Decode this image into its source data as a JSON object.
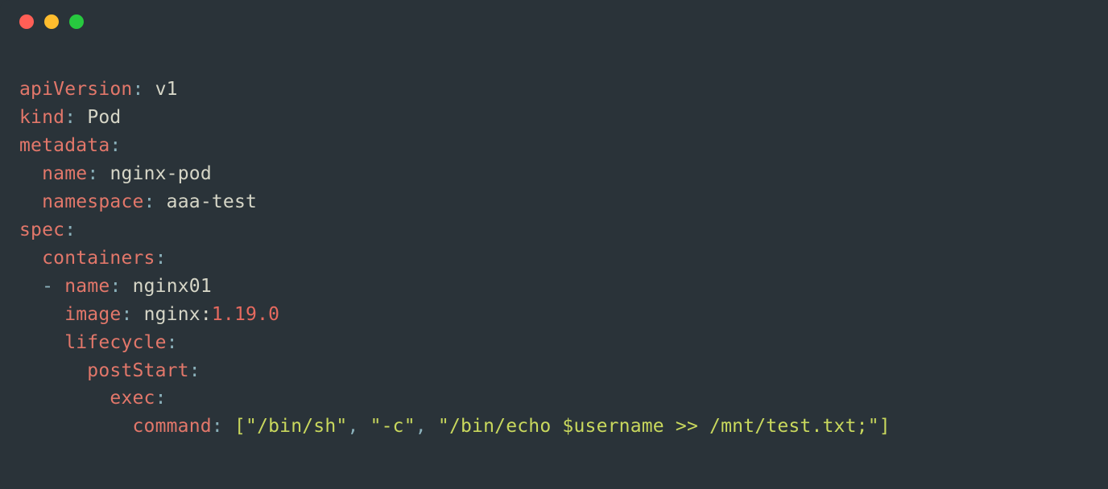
{
  "yaml": {
    "apiVersion_key": "apiVersion",
    "apiVersion_val": "v1",
    "kind_key": "kind",
    "kind_val": "Pod",
    "metadata_key": "metadata",
    "name_key": "name",
    "name_val": "nginx-pod",
    "namespace_key": "namespace",
    "namespace_val": "aaa-test",
    "spec_key": "spec",
    "containers_key": "containers",
    "dash": "-",
    "c_name_key": "name",
    "c_name_val": "nginx01",
    "image_key": "image",
    "image_prefix": "nginx:",
    "image_version": "1.19.0",
    "lifecycle_key": "lifecycle",
    "postStart_key": "postStart",
    "exec_key": "exec",
    "command_key": "command",
    "bracket_open": "[",
    "bracket_close": "]",
    "comma": ",",
    "cmd_arg1": "\"/bin/sh\"",
    "cmd_arg2": "\"-c\"",
    "cmd_arg3": "\"/bin/echo $username >> /mnt/test.txt;\"",
    "colon": ":"
  }
}
